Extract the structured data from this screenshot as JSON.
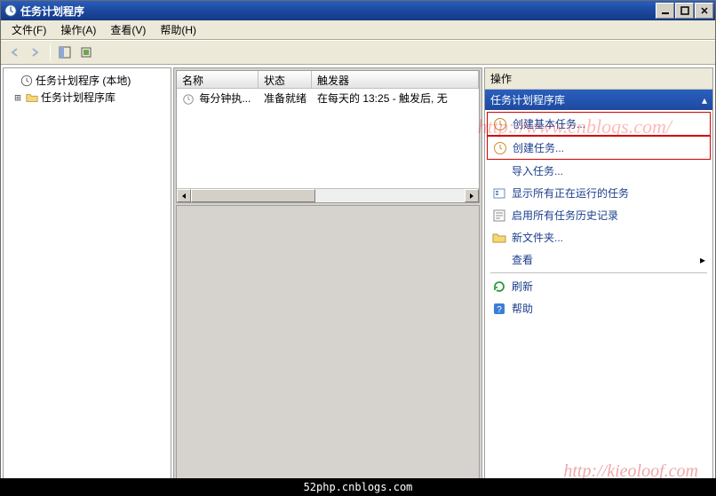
{
  "window": {
    "title": "任务计划程序"
  },
  "menu": {
    "file": "文件(F)",
    "action": "操作(A)",
    "view": "查看(V)",
    "help": "帮助(H)"
  },
  "tree": {
    "root": "任务计划程序 (本地)",
    "library": "任务计划程序库"
  },
  "list": {
    "headers": {
      "name": "名称",
      "status": "状态",
      "triggers": "触发器"
    },
    "rows": [
      {
        "name": "每分钟执...",
        "status": "准备就绪",
        "triggers": "在每天的 13:25 - 触发后, 无"
      }
    ]
  },
  "actions": {
    "title": "操作",
    "section": "任务计划程序库",
    "items": {
      "create_basic": "创建基本任务...",
      "create_task": "创建任务...",
      "import_task": "导入任务...",
      "show_running": "显示所有正在运行的任务",
      "enable_history": "启用所有任务历史记录",
      "new_folder": "新文件夹...",
      "view": "查看",
      "refresh": "刷新",
      "help": "帮助"
    }
  },
  "watermarks": {
    "w1": "http://www.cnblogs.com/",
    "w2": "http://kieoloof.com"
  },
  "caption": "52php.cnblogs.com"
}
